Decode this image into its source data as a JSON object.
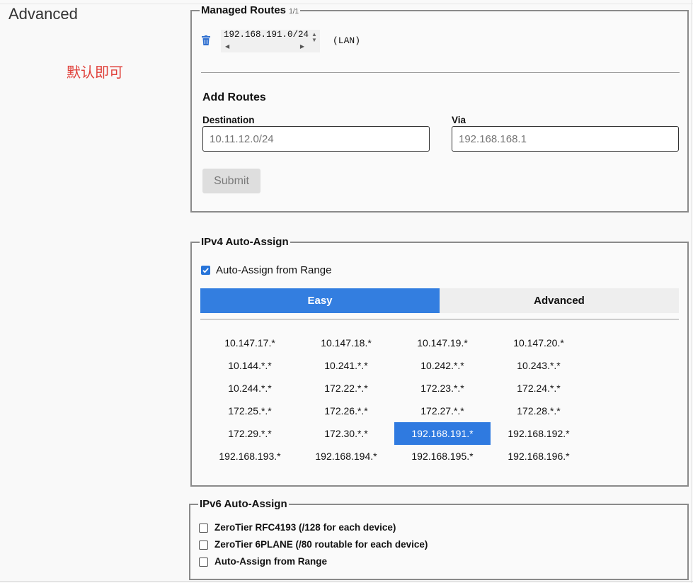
{
  "section_title": "Advanced",
  "annotation": "默认即可",
  "managed_routes": {
    "legend": "Managed Routes",
    "count": "1/1",
    "route_value": "192.168.191.0/24",
    "route_tag": "(LAN)",
    "add_title": "Add Routes",
    "destination_label": "Destination",
    "destination_placeholder": "10.11.12.0/24",
    "via_label": "Via",
    "via_placeholder": "192.168.168.1",
    "submit_label": "Submit"
  },
  "ipv4": {
    "legend": "IPv4 Auto-Assign",
    "auto_assign_label": "Auto-Assign from Range",
    "auto_assign_checked": true,
    "tabs": [
      "Easy",
      "Advanced"
    ],
    "active_tab": "Easy",
    "ranges": [
      [
        "10.147.17.*",
        "10.147.18.*",
        "10.147.19.*",
        "10.147.20.*"
      ],
      [
        "10.144.*.*",
        "10.241.*.*",
        "10.242.*.*",
        "10.243.*.*"
      ],
      [
        "10.244.*.*",
        "172.22.*.*",
        "172.23.*.*",
        "172.24.*.*"
      ],
      [
        "172.25.*.*",
        "172.26.*.*",
        "172.27.*.*",
        "172.28.*.*"
      ],
      [
        "172.29.*.*",
        "172.30.*.*",
        "192.168.191.*",
        "192.168.192.*"
      ],
      [
        "192.168.193.*",
        "192.168.194.*",
        "192.168.195.*",
        "192.168.196.*"
      ]
    ],
    "selected_range": "192.168.191.*"
  },
  "ipv6": {
    "legend": "IPv6 Auto-Assign",
    "options": [
      {
        "label": "ZeroTier RFC4193 (/128 for each device)",
        "checked": false
      },
      {
        "label": "ZeroTier 6PLANE (/80 routable for each device)",
        "checked": false
      },
      {
        "label": "Auto-Assign from Range",
        "checked": false
      }
    ]
  },
  "colors": {
    "accent": "#337ee0",
    "annotation": "#e0403a",
    "border": "#8a8a8a"
  }
}
